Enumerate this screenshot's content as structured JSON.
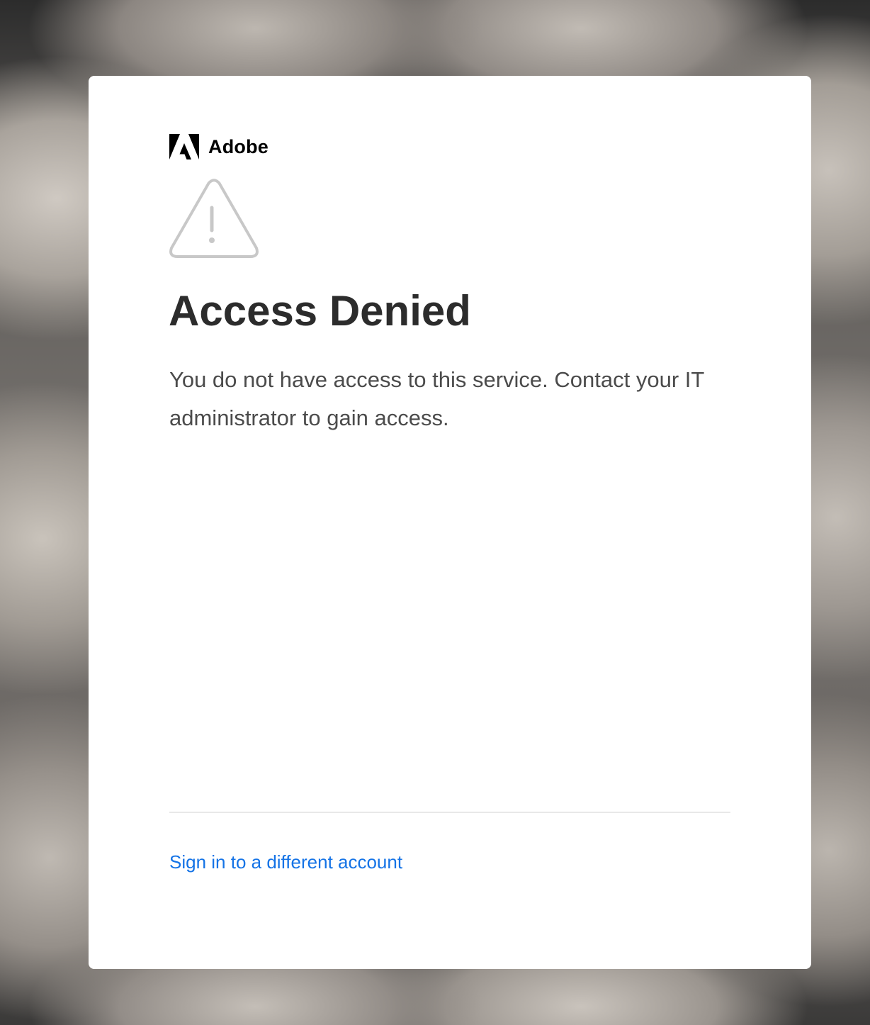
{
  "brand": {
    "name": "Adobe",
    "logo_icon": "adobe-logo-icon",
    "logo_color": "#000000"
  },
  "alert": {
    "icon": "warning-triangle-icon",
    "icon_color": "#c8c8c8",
    "title": "Access Denied",
    "message": "You do not have access to this service. Contact your IT administrator to gain access."
  },
  "footer": {
    "link_label": "Sign in to a different account",
    "link_color": "#1473e6"
  },
  "colors": {
    "card_background": "#ffffff",
    "title_text": "#2c2c2c",
    "body_text": "#4b4b4b",
    "divider": "#e8e8e8"
  }
}
